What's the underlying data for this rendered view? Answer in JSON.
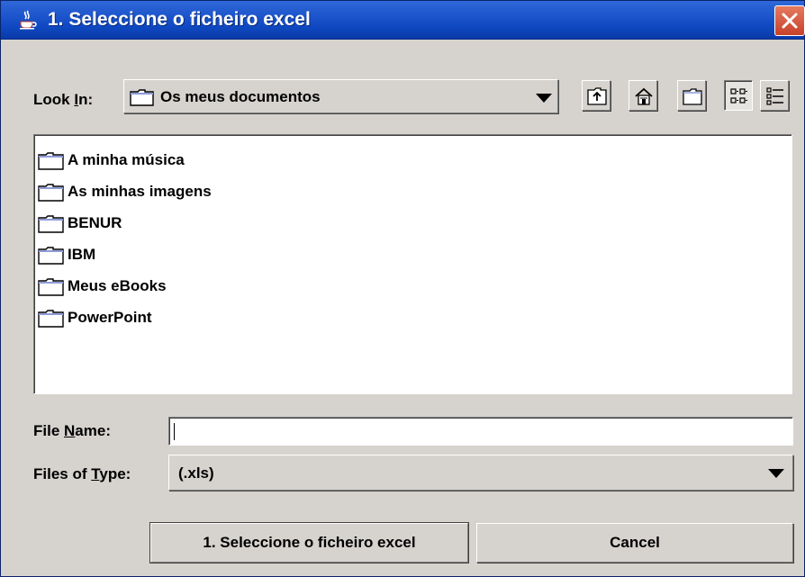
{
  "window": {
    "title": "1. Seleccione o ficheiro excel",
    "title_icon": "java-coffee-cup-icon",
    "close_icon": "close-icon"
  },
  "lookin": {
    "label_prefix": "Look ",
    "label_mnemonic": "I",
    "label_suffix": "n:",
    "value": "Os meus documentos",
    "value_icon": "folder-icon"
  },
  "toolbar": {
    "buttons": [
      {
        "name": "up-one-level-button",
        "icon": "folder-up-icon"
      },
      {
        "name": "home-button",
        "icon": "home-icon"
      },
      {
        "name": "new-folder-button",
        "icon": "new-folder-icon"
      },
      {
        "name": "list-view-button",
        "icon": "list-view-icon",
        "pressed": true
      },
      {
        "name": "details-view-button",
        "icon": "details-view-icon",
        "pressed": false
      }
    ]
  },
  "files": [
    {
      "name": "A minha música",
      "icon": "folder-icon"
    },
    {
      "name": "As minhas imagens",
      "icon": "folder-icon"
    },
    {
      "name": "BENUR",
      "icon": "folder-icon"
    },
    {
      "name": "IBM",
      "icon": "folder-icon"
    },
    {
      "name": "Meus eBooks",
      "icon": "folder-icon"
    },
    {
      "name": "PowerPoint",
      "icon": "folder-icon"
    }
  ],
  "filename": {
    "label_prefix": "File ",
    "label_mnemonic": "N",
    "label_suffix": "ame:",
    "value": ""
  },
  "filetype": {
    "label_prefix": "Files of ",
    "label_mnemonic": "T",
    "label_suffix": "ype:",
    "value": "(.xls)"
  },
  "actions": {
    "approve_label": "1. Seleccione o ficheiro excel",
    "cancel_label": "Cancel"
  },
  "colors": {
    "titlebar": "#0e47c0",
    "panel": "#d6d3ce",
    "close": "#c8412a"
  }
}
